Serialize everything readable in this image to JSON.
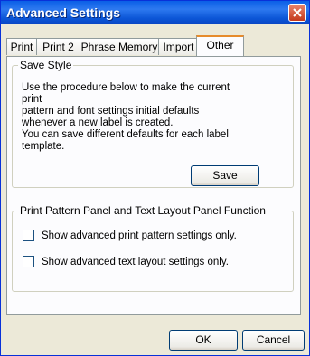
{
  "window": {
    "title": "Advanced Settings"
  },
  "tabs": [
    {
      "label": "Print"
    },
    {
      "label": "Print 2"
    },
    {
      "label": "Phrase Memory"
    },
    {
      "label": "Import"
    },
    {
      "label": "Other",
      "active": true
    }
  ],
  "save_style": {
    "legend": "Save Style",
    "lines": [
      "Use the procedure below to make the current print",
      "pattern and font settings initial defaults",
      "whenever a new label is created.",
      "You can save different defaults for each label template."
    ],
    "save_label": "Save"
  },
  "panel_function": {
    "legend": "Print Pattern Panel and Text Layout Panel Function",
    "options": [
      {
        "label": "Show advanced print pattern settings only.",
        "checked": false
      },
      {
        "label": "Show advanced text layout settings only.",
        "checked": false
      }
    ]
  },
  "footer": {
    "ok_label": "OK",
    "cancel_label": "Cancel"
  }
}
